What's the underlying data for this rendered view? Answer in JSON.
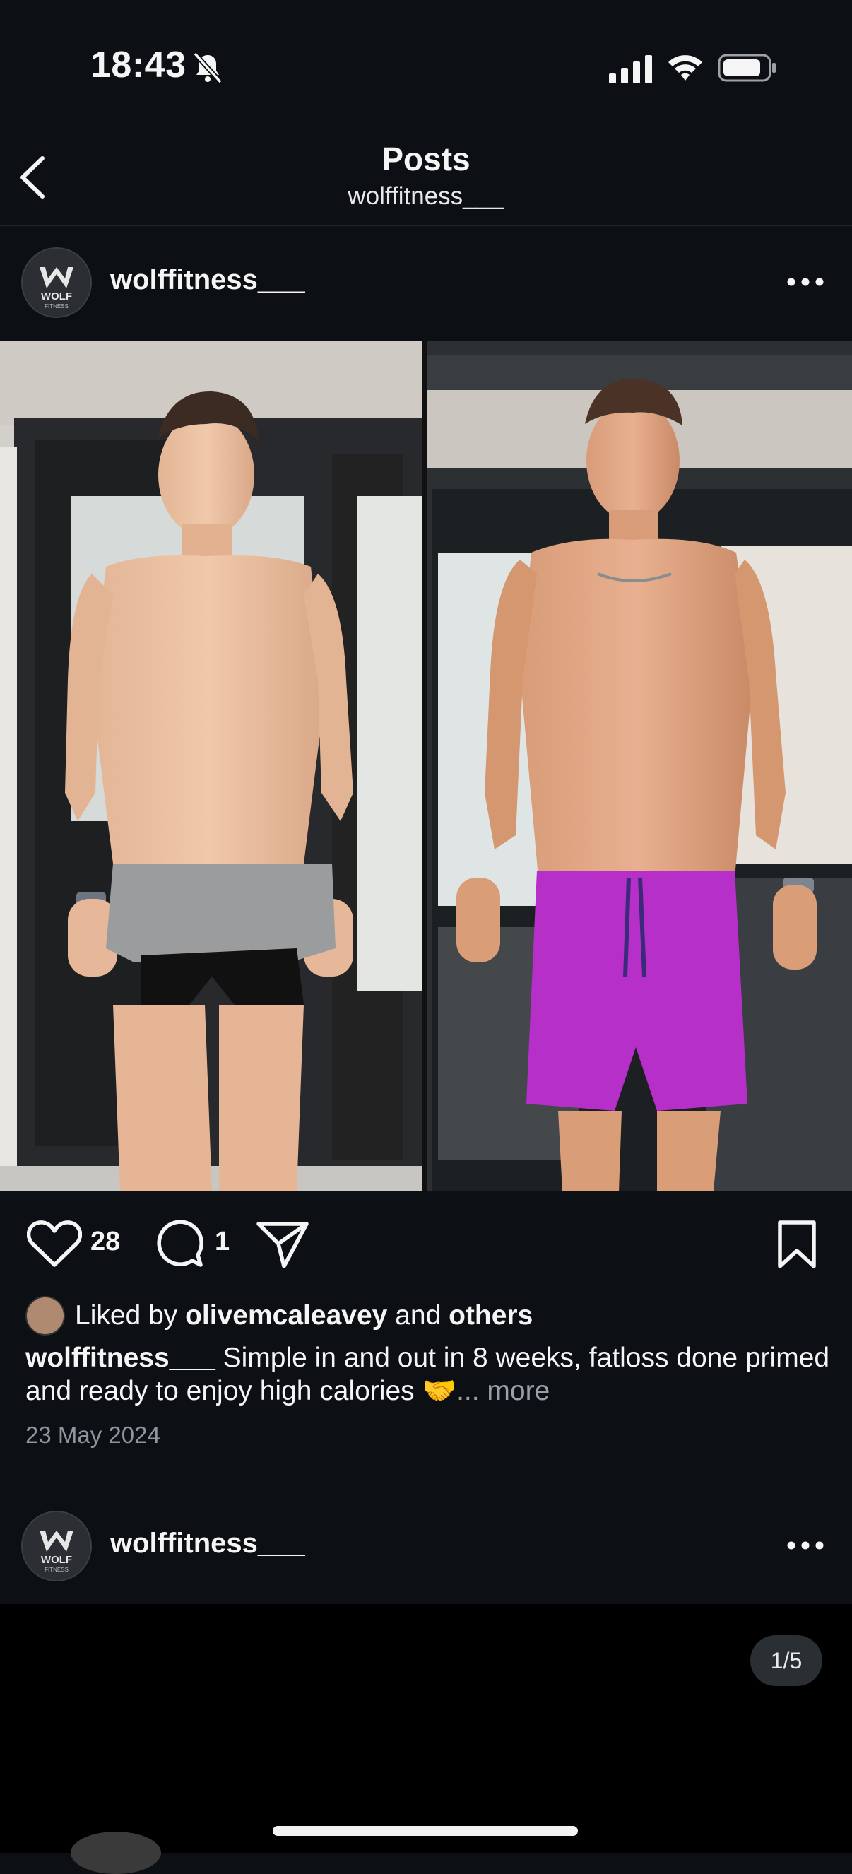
{
  "status_bar": {
    "time": "18:43"
  },
  "header": {
    "title": "Posts",
    "subtitle": "wolffitness___"
  },
  "post": {
    "avatar_text": "WOLF",
    "avatar_subtext": "FITNESS",
    "username": "wolffitness___",
    "likes": "28",
    "comments": "1",
    "liked_by_prefix": "Liked by",
    "liked_by_user": "olivemcaleavey",
    "liked_by_and": "and",
    "liked_by_others": "others",
    "caption_user": "wolffitness___",
    "caption_text": " Simple in and out in 8 weeks, fatloss done primed and ready to enjoy high calories 🤝",
    "caption_more": "... more",
    "date": "23 May 2024"
  },
  "next_post": {
    "avatar_text": "WOLF",
    "avatar_subtext": "FITNESS",
    "username": "wolffitness___",
    "pager": "1/5"
  },
  "colors": {
    "background": "#0c1014",
    "text": "#f5f5f5",
    "muted": "#8f959b",
    "shorts_left": "#9a9a9a",
    "shorts_right": "#b62fc8"
  }
}
